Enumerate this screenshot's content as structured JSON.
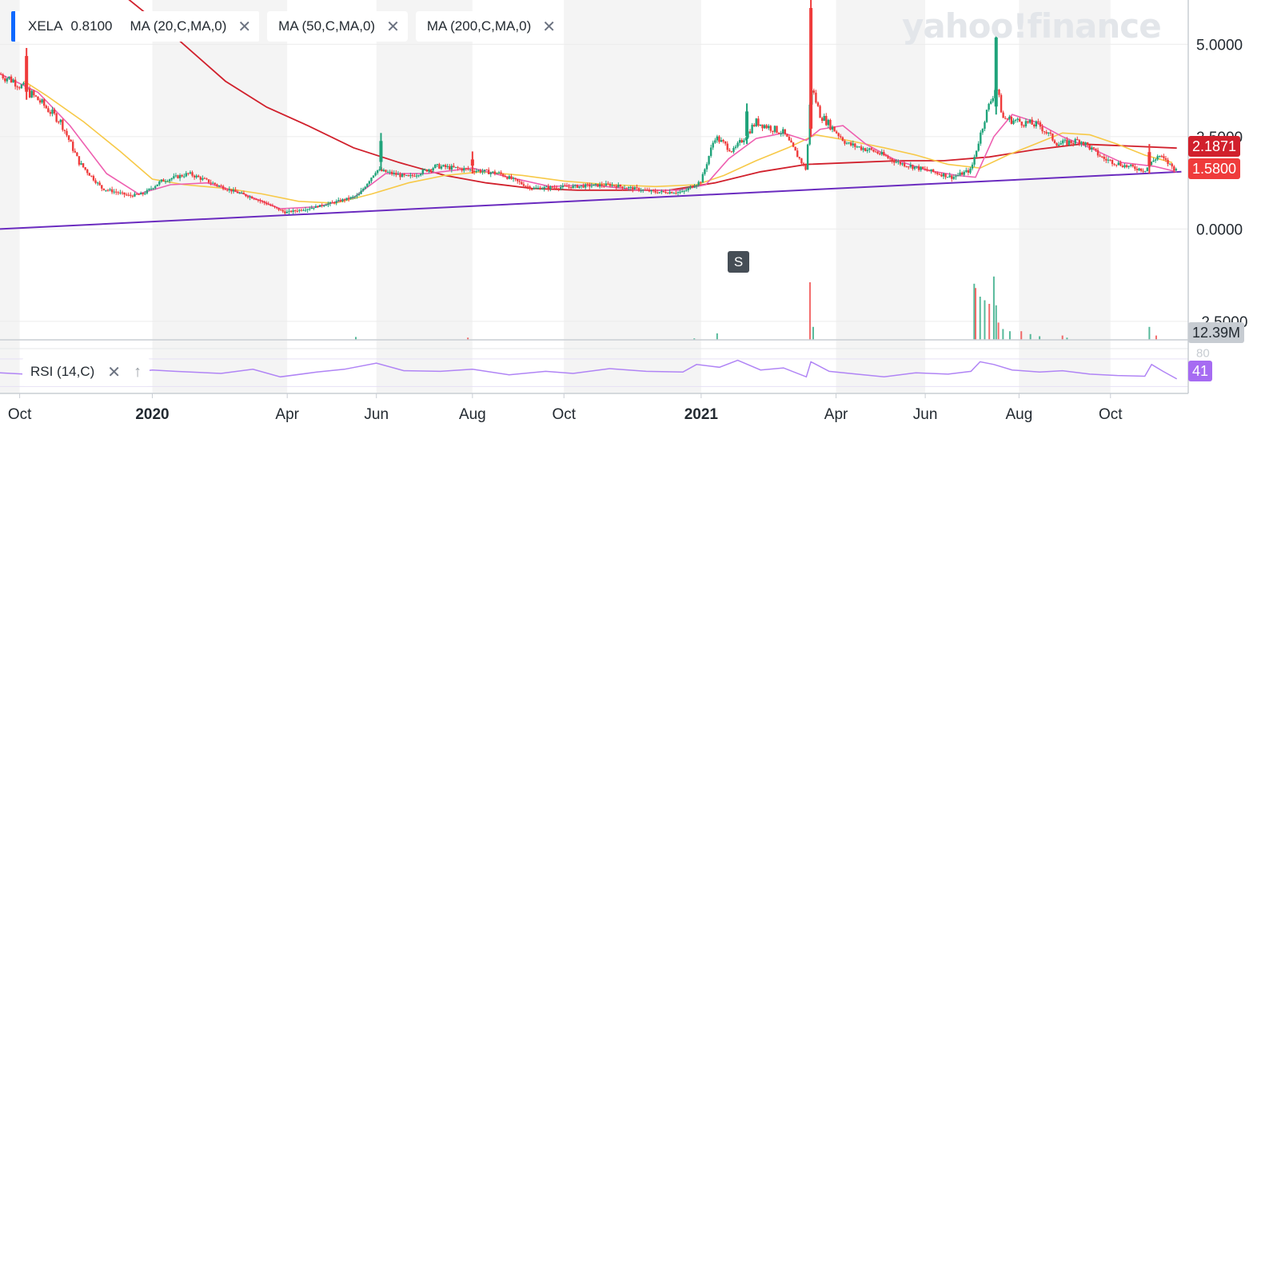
{
  "legend": {
    "ticker": "XELA",
    "price": "0.8100",
    "indicators": [
      {
        "label": "MA (20,C,MA,0)",
        "close": "✕"
      },
      {
        "label": "MA (50,C,MA,0)",
        "close": "✕"
      },
      {
        "label": "MA (200,C,MA,0)",
        "close": "✕"
      }
    ]
  },
  "watermark": "yahoo!finance",
  "event_marker": "S",
  "rsi_panel": {
    "label": "RSI (14,C)",
    "close": "✕",
    "arrow": "↑",
    "value": "41",
    "top_tick": "80"
  },
  "price_tags": {
    "ma200": "2.1871",
    "last": "1.5800",
    "volume": "12.39M"
  },
  "colors": {
    "up": "#1fa37a",
    "down": "#ef3b3b",
    "ma20": "#ee5fb0",
    "ma50": "#f7c948",
    "ma200": "#d1202c",
    "trendline": "#6a2bbf",
    "rsi": "#b084f5",
    "accent": "#0f69ff",
    "band": "#f4f4f4",
    "tag_ma200": "#d1202c",
    "tag_last": "#ef3b3b",
    "tag_rsi": "#a66bf2",
    "tag_volume": "#c7ccd2"
  },
  "chart_data": {
    "type": "candlestick",
    "y_ticks": [
      "5.0000",
      "2.5000",
      "0.0000",
      "-2.5000"
    ],
    "ylim": [
      -3.0,
      6.2
    ],
    "x_labels": [
      {
        "label": "Oct",
        "x": 0.1
      },
      {
        "label": "2020",
        "x": 3.0,
        "bold": true
      },
      {
        "label": "Apr",
        "x": 5.95
      },
      {
        "label": "Jun",
        "x": 7.9
      },
      {
        "label": "Aug",
        "x": 10.0
      },
      {
        "label": "Oct",
        "x": 12.0
      },
      {
        "label": "2021",
        "x": 15.0,
        "bold": true
      },
      {
        "label": "Apr",
        "x": 17.95
      },
      {
        "label": "Jun",
        "x": 19.9
      },
      {
        "label": "Aug",
        "x": 21.95
      },
      {
        "label": "Oct",
        "x": 23.95
      }
    ],
    "xlim": [
      -0.33,
      25.65
    ],
    "shaded_bands": [
      [
        -0.33,
        0.1
      ],
      [
        3.0,
        5.95
      ],
      [
        7.9,
        10.0
      ],
      [
        12.0,
        15.0
      ],
      [
        17.95,
        19.9
      ],
      [
        21.95,
        23.95
      ]
    ],
    "close_path": [
      [
        -0.33,
        4.2
      ],
      [
        0.0,
        4.0
      ],
      [
        0.5,
        3.5
      ],
      [
        1.0,
        2.9
      ],
      [
        1.4,
        1.8
      ],
      [
        1.9,
        1.1
      ],
      [
        2.5,
        0.9
      ],
      [
        2.8,
        0.95
      ],
      [
        3.2,
        1.3
      ],
      [
        3.8,
        1.5
      ],
      [
        4.6,
        1.1
      ],
      [
        5.3,
        0.8
      ],
      [
        5.9,
        0.45
      ],
      [
        6.4,
        0.55
      ],
      [
        6.9,
        0.7
      ],
      [
        7.5,
        0.9
      ],
      [
        7.9,
        1.6
      ],
      [
        8.6,
        1.4
      ],
      [
        9.2,
        1.7
      ],
      [
        10.0,
        1.6
      ],
      [
        10.6,
        1.5
      ],
      [
        11.3,
        1.1
      ],
      [
        12.2,
        1.15
      ],
      [
        13.0,
        1.2
      ],
      [
        14.0,
        1.0
      ],
      [
        14.6,
        1.0
      ],
      [
        15.0,
        1.3
      ],
      [
        15.3,
        2.5
      ],
      [
        15.7,
        2.1
      ],
      [
        16.2,
        2.9
      ],
      [
        16.8,
        2.6
      ],
      [
        17.3,
        1.6
      ],
      [
        17.4,
        3.9
      ],
      [
        17.6,
        3.1
      ],
      [
        18.2,
        2.3
      ],
      [
        18.8,
        2.1
      ],
      [
        19.3,
        1.8
      ],
      [
        19.9,
        1.6
      ],
      [
        20.5,
        1.4
      ],
      [
        20.9,
        1.6
      ],
      [
        21.2,
        3.0
      ],
      [
        21.45,
        3.9
      ],
      [
        21.6,
        3.0
      ],
      [
        22.0,
        2.9
      ],
      [
        22.4,
        2.8
      ],
      [
        22.8,
        2.3
      ],
      [
        23.3,
        2.4
      ],
      [
        23.8,
        1.9
      ],
      [
        24.3,
        1.7
      ],
      [
        24.7,
        1.6
      ],
      [
        25.0,
        2.0
      ],
      [
        25.4,
        1.58
      ]
    ],
    "spikes": [
      {
        "x": 0.25,
        "high": 4.9,
        "low": 3.5
      },
      {
        "x": 8.0,
        "high": 2.6,
        "low": 1.6
      },
      {
        "x": 10.0,
        "high": 2.1,
        "low": 1.5
      },
      {
        "x": 16.0,
        "high": 3.4,
        "low": 2.3
      },
      {
        "x": 17.4,
        "high": 6.2,
        "low": 2.5
      },
      {
        "x": 21.45,
        "high": 5.4,
        "low": 3.1
      },
      {
        "x": 24.8,
        "high": 2.3,
        "low": 1.5
      }
    ],
    "ma20": [
      [
        -0.33,
        4.2
      ],
      [
        0.5,
        3.7
      ],
      [
        1.2,
        2.8
      ],
      [
        2.0,
        1.5
      ],
      [
        2.7,
        0.95
      ],
      [
        3.4,
        1.2
      ],
      [
        4.2,
        1.25
      ],
      [
        5.0,
        0.95
      ],
      [
        5.8,
        0.55
      ],
      [
        6.6,
        0.6
      ],
      [
        7.4,
        0.85
      ],
      [
        8.1,
        1.5
      ],
      [
        9.0,
        1.5
      ],
      [
        10.0,
        1.65
      ],
      [
        10.8,
        1.4
      ],
      [
        11.7,
        1.15
      ],
      [
        12.6,
        1.2
      ],
      [
        13.6,
        1.05
      ],
      [
        14.5,
        1.05
      ],
      [
        15.1,
        1.2
      ],
      [
        15.6,
        1.9
      ],
      [
        16.2,
        2.45
      ],
      [
        16.8,
        2.6
      ],
      [
        17.3,
        2.4
      ],
      [
        17.6,
        2.7
      ],
      [
        18.1,
        2.8
      ],
      [
        18.6,
        2.3
      ],
      [
        19.2,
        1.9
      ],
      [
        19.9,
        1.6
      ],
      [
        20.6,
        1.45
      ],
      [
        21.0,
        1.4
      ],
      [
        21.4,
        2.5
      ],
      [
        21.8,
        3.1
      ],
      [
        22.3,
        2.9
      ],
      [
        22.9,
        2.5
      ],
      [
        23.5,
        2.2
      ],
      [
        24.2,
        1.8
      ],
      [
        24.9,
        1.7
      ],
      [
        25.4,
        1.55
      ]
    ],
    "ma50": [
      [
        0.2,
        4.0
      ],
      [
        0.7,
        3.6
      ],
      [
        1.5,
        2.9
      ],
      [
        2.3,
        2.1
      ],
      [
        3.0,
        1.35
      ],
      [
        3.7,
        1.2
      ],
      [
        4.6,
        1.1
      ],
      [
        5.4,
        0.95
      ],
      [
        6.2,
        0.75
      ],
      [
        7.0,
        0.7
      ],
      [
        7.8,
        0.95
      ],
      [
        8.6,
        1.25
      ],
      [
        9.4,
        1.45
      ],
      [
        10.2,
        1.55
      ],
      [
        11.1,
        1.45
      ],
      [
        12.0,
        1.3
      ],
      [
        13.0,
        1.2
      ],
      [
        14.0,
        1.15
      ],
      [
        14.9,
        1.2
      ],
      [
        15.5,
        1.45
      ],
      [
        16.2,
        1.85
      ],
      [
        16.9,
        2.2
      ],
      [
        17.5,
        2.55
      ],
      [
        18.2,
        2.4
      ],
      [
        19.0,
        2.2
      ],
      [
        19.7,
        2.0
      ],
      [
        20.4,
        1.75
      ],
      [
        21.1,
        1.65
      ],
      [
        21.7,
        2.0
      ],
      [
        22.3,
        2.3
      ],
      [
        22.9,
        2.6
      ],
      [
        23.5,
        2.55
      ],
      [
        24.1,
        2.3
      ],
      [
        24.7,
        2.0
      ],
      [
        25.3,
        1.8
      ]
    ],
    "ma200": [
      [
        2.3,
        6.4
      ],
      [
        3.5,
        5.2
      ],
      [
        4.6,
        4.0
      ],
      [
        5.5,
        3.3
      ],
      [
        6.4,
        2.8
      ],
      [
        7.4,
        2.2
      ],
      [
        8.4,
        1.8
      ],
      [
        9.4,
        1.45
      ],
      [
        10.3,
        1.25
      ],
      [
        11.3,
        1.1
      ],
      [
        12.3,
        1.05
      ],
      [
        13.3,
        1.05
      ],
      [
        14.3,
        1.05
      ],
      [
        15.3,
        1.25
      ],
      [
        16.3,
        1.55
      ],
      [
        17.3,
        1.75
      ],
      [
        18.3,
        1.8
      ],
      [
        19.3,
        1.85
      ],
      [
        20.3,
        1.85
      ],
      [
        21.3,
        1.95
      ],
      [
        22.3,
        2.15
      ],
      [
        23.3,
        2.3
      ],
      [
        24.3,
        2.25
      ],
      [
        25.4,
        2.19
      ]
    ],
    "trendline": [
      [
        -0.33,
        0.0
      ],
      [
        25.5,
        1.55
      ]
    ],
    "volume": [
      [
        7.45,
        4
      ],
      [
        9.9,
        3
      ],
      [
        14.85,
        2
      ],
      [
        15.35,
        9
      ],
      [
        17.38,
        80
      ],
      [
        17.45,
        18
      ],
      [
        20.97,
        78
      ],
      [
        21.0,
        72
      ],
      [
        21.1,
        60
      ],
      [
        21.2,
        55
      ],
      [
        21.3,
        50
      ],
      [
        21.4,
        88
      ],
      [
        21.45,
        48
      ],
      [
        21.5,
        24
      ],
      [
        21.6,
        15
      ],
      [
        21.75,
        12
      ],
      [
        22.0,
        12
      ],
      [
        22.2,
        8
      ],
      [
        22.4,
        5
      ],
      [
        22.9,
        6
      ],
      [
        23.0,
        3
      ],
      [
        24.8,
        18
      ],
      [
        24.95,
        6
      ]
    ],
    "rsi": [
      [
        -0.33,
        50
      ],
      [
        0.5,
        47
      ],
      [
        1.0,
        52
      ],
      [
        2.0,
        46
      ],
      [
        3.0,
        54
      ],
      [
        3.5,
        52
      ],
      [
        4.5,
        49
      ],
      [
        5.2,
        55
      ],
      [
        5.8,
        44
      ],
      [
        6.6,
        51
      ],
      [
        7.2,
        55
      ],
      [
        7.9,
        64
      ],
      [
        8.5,
        53
      ],
      [
        9.3,
        52
      ],
      [
        10.0,
        55
      ],
      [
        10.8,
        47
      ],
      [
        11.6,
        52
      ],
      [
        12.2,
        49
      ],
      [
        13.0,
        56
      ],
      [
        13.8,
        52
      ],
      [
        14.6,
        51
      ],
      [
        14.9,
        62
      ],
      [
        15.4,
        58
      ],
      [
        15.8,
        68
      ],
      [
        16.3,
        54
      ],
      [
        16.8,
        57
      ],
      [
        17.3,
        44
      ],
      [
        17.4,
        66
      ],
      [
        17.8,
        52
      ],
      [
        18.4,
        48
      ],
      [
        19.0,
        44
      ],
      [
        19.7,
        50
      ],
      [
        20.4,
        48
      ],
      [
        20.9,
        52
      ],
      [
        21.1,
        66
      ],
      [
        21.4,
        62
      ],
      [
        21.8,
        54
      ],
      [
        22.4,
        51
      ],
      [
        22.9,
        53
      ],
      [
        23.5,
        48
      ],
      [
        24.1,
        46
      ],
      [
        24.7,
        45
      ],
      [
        24.85,
        62
      ],
      [
        25.1,
        52
      ],
      [
        25.4,
        41
      ]
    ]
  }
}
